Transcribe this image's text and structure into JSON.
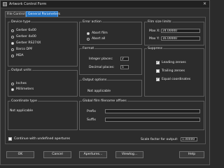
{
  "window": {
    "title": "Artwork Control Form",
    "close_glyph": "✕",
    "app_icon": "form-icon"
  },
  "tabs": [
    "File Control",
    "General Parameters"
  ],
  "device_type": {
    "title": "Device type",
    "options": [
      "Gerber 6x00",
      "Gerber 4x00",
      "Gerber RS274X",
      "Barco DPF",
      "MDA"
    ],
    "selected": "Gerber RS274X"
  },
  "output_units": {
    "title": "Output units",
    "options": [
      "Inches",
      "Millimeters"
    ],
    "selected": "Millimeters"
  },
  "coordinate_type": {
    "title": "Coordinate type",
    "value": "Not applicable"
  },
  "error_action": {
    "title": "Error action",
    "options": [
      "Abort film",
      "Abort all"
    ],
    "selected": "Abort film"
  },
  "format": {
    "title": "Format",
    "integer_label": "Integer places:",
    "integer_value": "2",
    "decimal_label": "Decimal places:",
    "decimal_value": "5"
  },
  "output_options": {
    "title": "Output options",
    "value": "Not applicable"
  },
  "film_size_limits": {
    "title": "Film size limits",
    "max_x_label": "Max X:",
    "max_x_value": "24.00000",
    "max_y_label": "Max Y:",
    "max_y_value": "16.00000"
  },
  "suppress": {
    "title": "Suppress",
    "items": [
      {
        "label": "Leading zeroes",
        "checked": true
      },
      {
        "label": "Trailing zeroes",
        "checked": false
      },
      {
        "label": "Equal coordinates",
        "checked": true
      }
    ]
  },
  "global_affixes": {
    "title": "Global film filename affixes",
    "prefix_label": "Prefix",
    "prefix_value": "",
    "suffix_label": "Suffix",
    "suffix_value": ""
  },
  "continue_undefined": {
    "label": "Continue with undefined apertures",
    "checked": false
  },
  "scale": {
    "label": "Scale factor for output:",
    "value": "1.00000"
  },
  "buttons": {
    "ok": "OK",
    "cancel": "Cancel",
    "apertures": "Apertures...",
    "viewlog": "Viewlog...",
    "help": "Help"
  },
  "colors": {
    "accent": "#1f6fbf",
    "background": "#2f2f2f",
    "border": "#5c5c5c"
  }
}
